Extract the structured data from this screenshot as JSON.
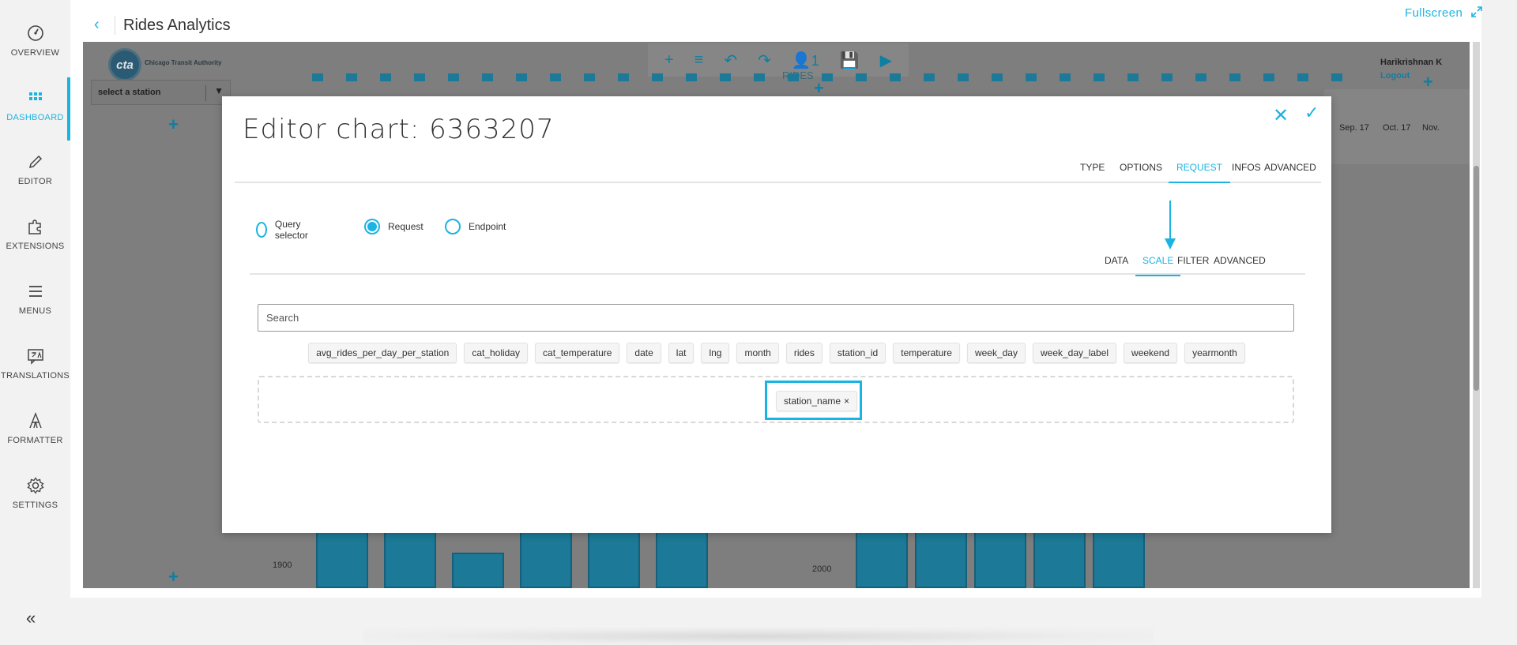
{
  "sidebar": {
    "items": [
      {
        "label": "OVERVIEW",
        "icon": "gauge-icon"
      },
      {
        "label": "DASHBOARD",
        "icon": "grid-icon",
        "active": true
      },
      {
        "label": "EDITOR",
        "icon": "pencil-icon"
      },
      {
        "label": "EXTENSIONS",
        "icon": "puzzle-icon"
      },
      {
        "label": "MENUS",
        "icon": "hamburger-icon"
      },
      {
        "label": "TRANSLATIONS",
        "icon": "translate-icon"
      },
      {
        "label": "FORMATTER",
        "icon": "formatter-icon"
      },
      {
        "label": "SETTINGS",
        "icon": "gear-icon"
      }
    ],
    "collapse_glyph": "«"
  },
  "header": {
    "back_glyph": "‹",
    "title": "Rides Analytics",
    "fullscreen_label": "Fullscreen"
  },
  "dashboard": {
    "logo_text": "cta",
    "logo_caption": "Chicago Transit Authority",
    "user_name": "Harikrishnan K",
    "logout_label": "Logout",
    "station_placeholder": "select a station",
    "chart_title": "RIDES",
    "toolbar_user_count": "1",
    "axis_labels": [
      "1900",
      "2000"
    ],
    "date_labels": [
      "Sep. 17",
      "Oct. 17",
      "Nov."
    ],
    "accent_color": "#1c7a98"
  },
  "modal": {
    "title": "Editor chart: 6363207",
    "tabs": [
      "TYPE",
      "OPTIONS",
      "REQUEST",
      "INFOS",
      "ADVANCED"
    ],
    "active_tab": "REQUEST",
    "request_modes": [
      {
        "label": "Query selector",
        "selected": false
      },
      {
        "label": "Request",
        "selected": true
      },
      {
        "label": "Endpoint",
        "selected": false
      }
    ],
    "sub_tabs": [
      "DATA",
      "SCALE",
      "FILTER",
      "ADVANCED"
    ],
    "active_sub_tab": "SCALE",
    "search_placeholder": "Search",
    "fields": [
      "avg_rides_per_day_per_station",
      "cat_holiday",
      "cat_temperature",
      "date",
      "lat",
      "lng",
      "month",
      "rides",
      "station_id",
      "temperature",
      "week_day",
      "week_day_label",
      "weekend",
      "yearmonth"
    ],
    "selected_field": "station_name",
    "remove_glyph": "×",
    "accent_color": "#1ab4e3"
  }
}
